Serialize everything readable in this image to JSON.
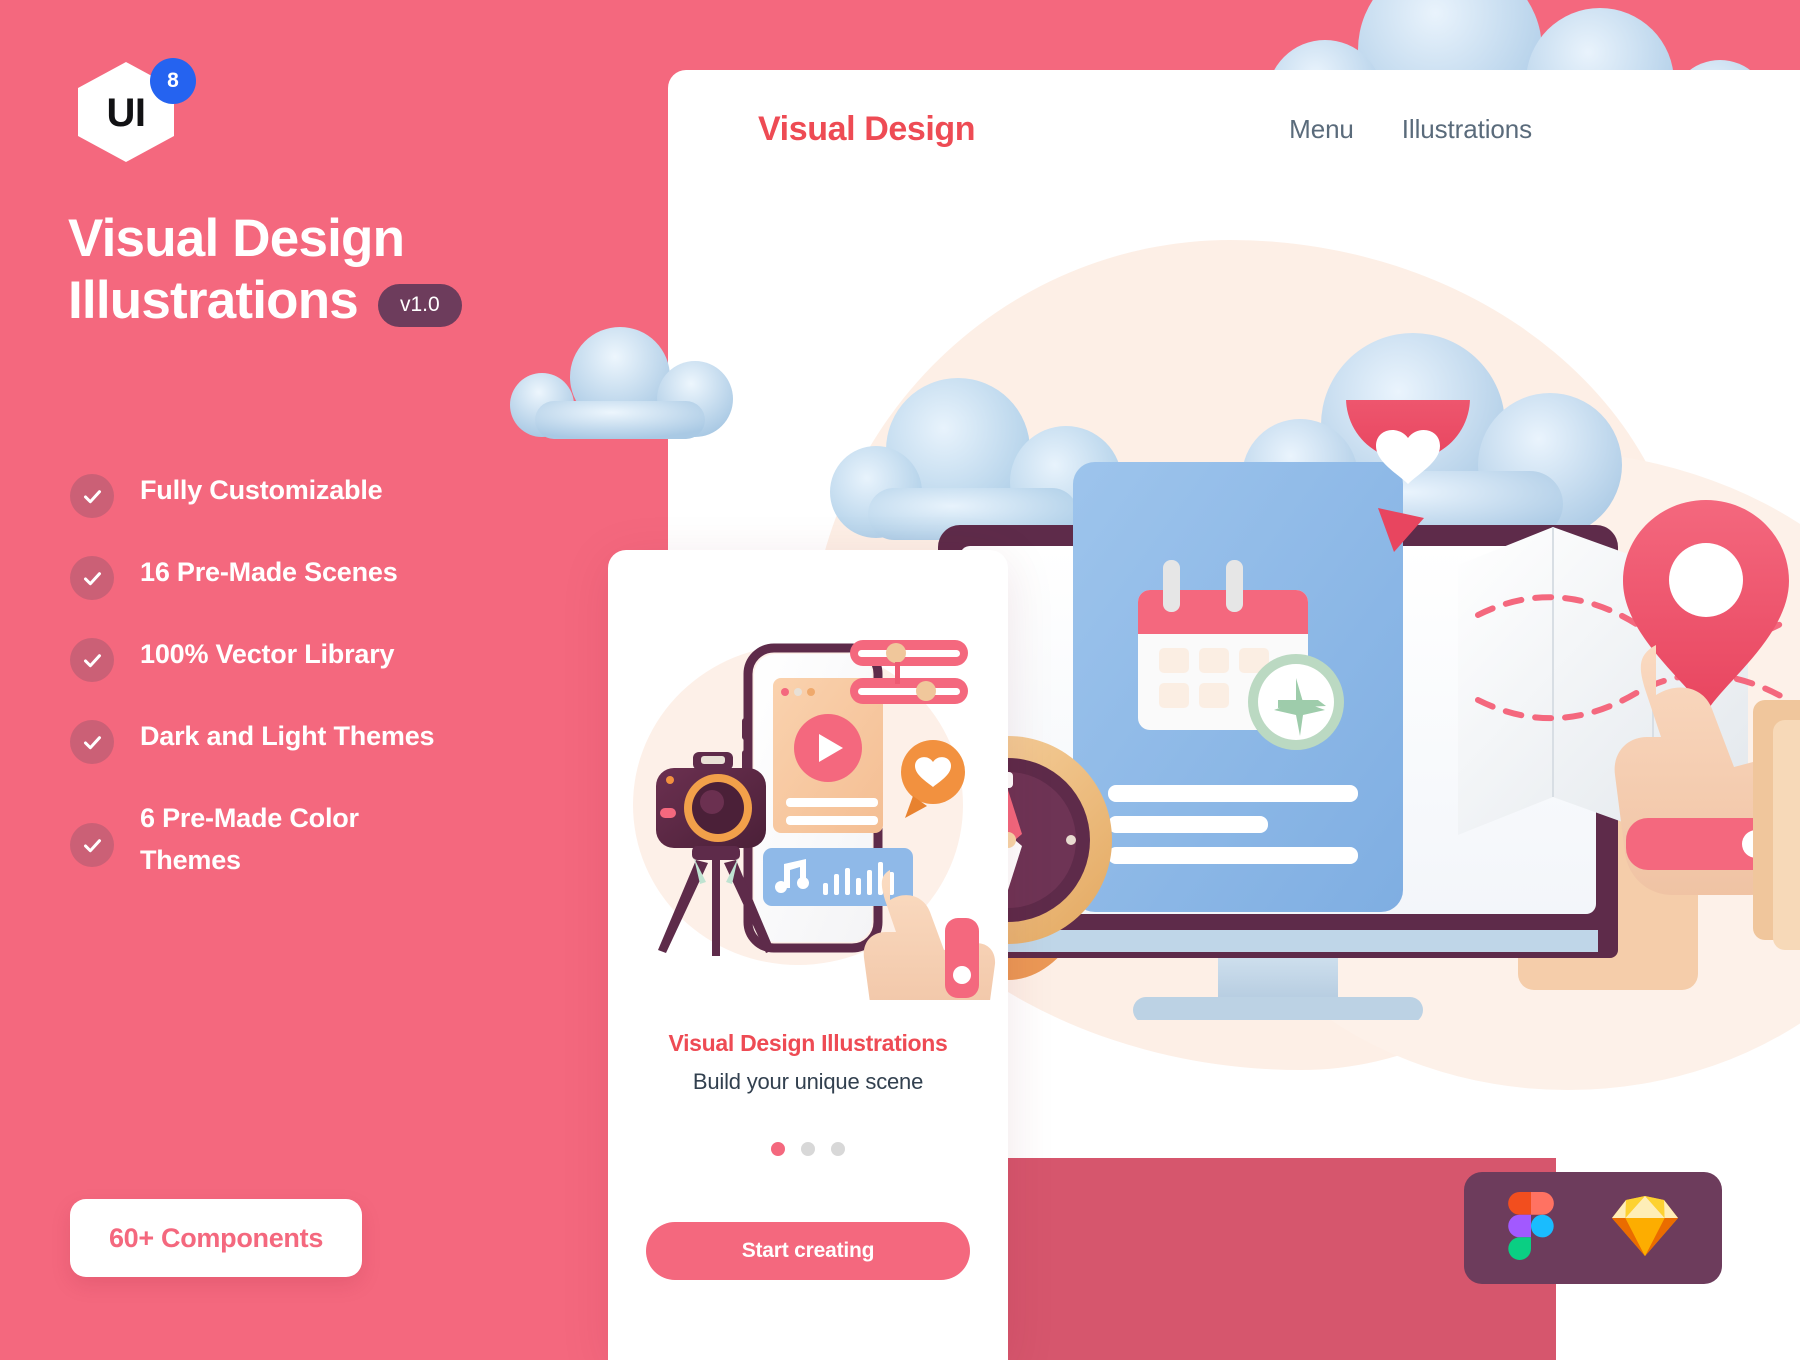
{
  "theme": {
    "brand_pink": "#F4687E",
    "brand_red": "#EE4B54",
    "plum": "#6D3C5C",
    "badge_blue": "#2563F0",
    "cream": "#FDEFE6",
    "slate": "#32404F",
    "nav_grey": "#5A6B7B",
    "check_circle": "#CB6076",
    "bottom_strip": "#D6566D"
  },
  "logo": {
    "mark_text": "UI",
    "badge_number": "8",
    "name": "ui8-logo"
  },
  "hero": {
    "title_line1": "Visual Design",
    "title_line2": "Illustrations",
    "version_badge": "v1.0"
  },
  "features": [
    {
      "label": "Fully Customizable",
      "icon": "check-icon"
    },
    {
      "label": "16 Pre-Made Scenes",
      "icon": "check-icon"
    },
    {
      "label": "100% Vector Library",
      "icon": "check-icon"
    },
    {
      "label": "Dark and Light Themes",
      "icon": "check-icon"
    },
    {
      "label": "6 Pre-Made Color Themes",
      "icon": "check-icon"
    }
  ],
  "components_pill": {
    "label": "60+ Components"
  },
  "browser": {
    "brand_title": "Visual Design",
    "nav": [
      {
        "label": "Menu"
      },
      {
        "label": "Illustrations"
      }
    ]
  },
  "mobile_card": {
    "title": "Visual Design Illustrations",
    "subtitle": "Build your unique scene",
    "dots": [
      {
        "active": true
      },
      {
        "active": false
      },
      {
        "active": false
      }
    ],
    "cta_label": "Start creating"
  },
  "tool_badge": {
    "tools": [
      {
        "name": "figma-icon"
      },
      {
        "name": "sketch-icon"
      }
    ]
  }
}
